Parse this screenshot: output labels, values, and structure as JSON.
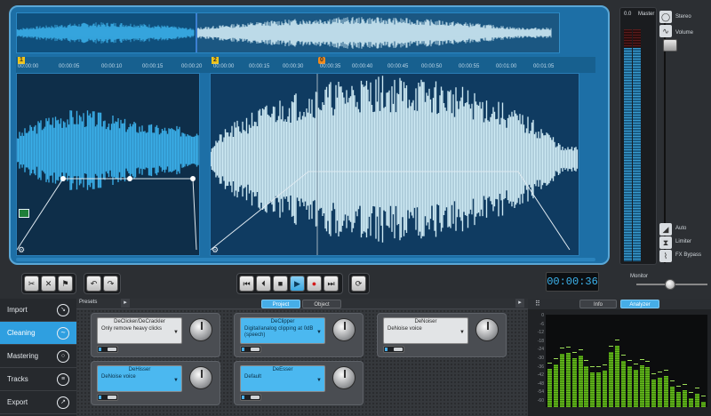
{
  "ruler": {
    "marker_a": "1",
    "marker_b": "2",
    "marker_c": "0",
    "ticks": [
      "00:00:00",
      "00:00:05",
      "00:00:10",
      "00:00:15",
      "00:00:20",
      "00:00:00",
      "00:00:15",
      "00:00:30",
      "00:00:35",
      "00:00:40",
      "00:00:45",
      "00:00:50",
      "00:00:55",
      "00:01:00",
      "00:01:05"
    ]
  },
  "master": {
    "level_value": "0.0",
    "label": "Master",
    "stereo_label": "Stereo",
    "volume_label": "Volume",
    "auto_label": "Auto",
    "limiter_label": "Limiter",
    "fx_bypass_label": "FX Bypass"
  },
  "transport": {
    "timecode": "00:00:36",
    "monitor_label": "Monitor"
  },
  "nav": {
    "items": [
      {
        "label": "Import",
        "icon": "import-icon",
        "active": false
      },
      {
        "label": "Cleaning",
        "icon": "cleaning-icon",
        "active": true
      },
      {
        "label": "Mastering",
        "icon": "mastering-icon",
        "active": false
      },
      {
        "label": "Tracks",
        "icon": "tracks-icon",
        "active": false
      },
      {
        "label": "Export",
        "icon": "export-icon",
        "active": false
      }
    ]
  },
  "fx": {
    "presets_label": "Presets",
    "tabs": [
      {
        "label": "Project",
        "active": true
      },
      {
        "label": "Object",
        "active": false
      }
    ],
    "modules": [
      {
        "title": "DeClicker/DeCrackler",
        "value": "Only remove heavy clicks",
        "blue": false
      },
      {
        "title": "DeClipper",
        "value": "Digital/analog clipping at 0dB (speech)",
        "blue": true
      },
      {
        "title": "DeNoiser",
        "value": "DeNoise voice",
        "blue": false
      },
      {
        "title": "DeHisser",
        "value": "DeNoise voice",
        "blue": true
      },
      {
        "title": "DeEsser",
        "value": "Default",
        "blue": true
      }
    ]
  },
  "analyzer": {
    "tabs": [
      {
        "label": "Info",
        "active": false
      },
      {
        "label": "Analyzer",
        "active": true
      }
    ],
    "db_labels": [
      "0",
      "-6",
      "-12",
      "-18",
      "-24",
      "-30",
      "-36",
      "-42",
      "-48",
      "-54",
      "-60"
    ],
    "bar_levels": [
      0.41,
      0.46,
      0.58,
      0.59,
      0.53,
      0.56,
      0.44,
      0.38,
      0.38,
      0.39,
      0.6,
      0.66,
      0.5,
      0.44,
      0.4,
      0.45,
      0.43,
      0.3,
      0.32,
      0.34,
      0.22,
      0.16,
      0.18,
      0.1,
      0.14,
      0.06
    ],
    "bar_color": "#6bc01f"
  },
  "colors": {
    "accent": "#2f9fe0",
    "waveform": "#3aaee8",
    "waveform_selected": "#cde9f3",
    "timecode": "#3db4ee"
  }
}
